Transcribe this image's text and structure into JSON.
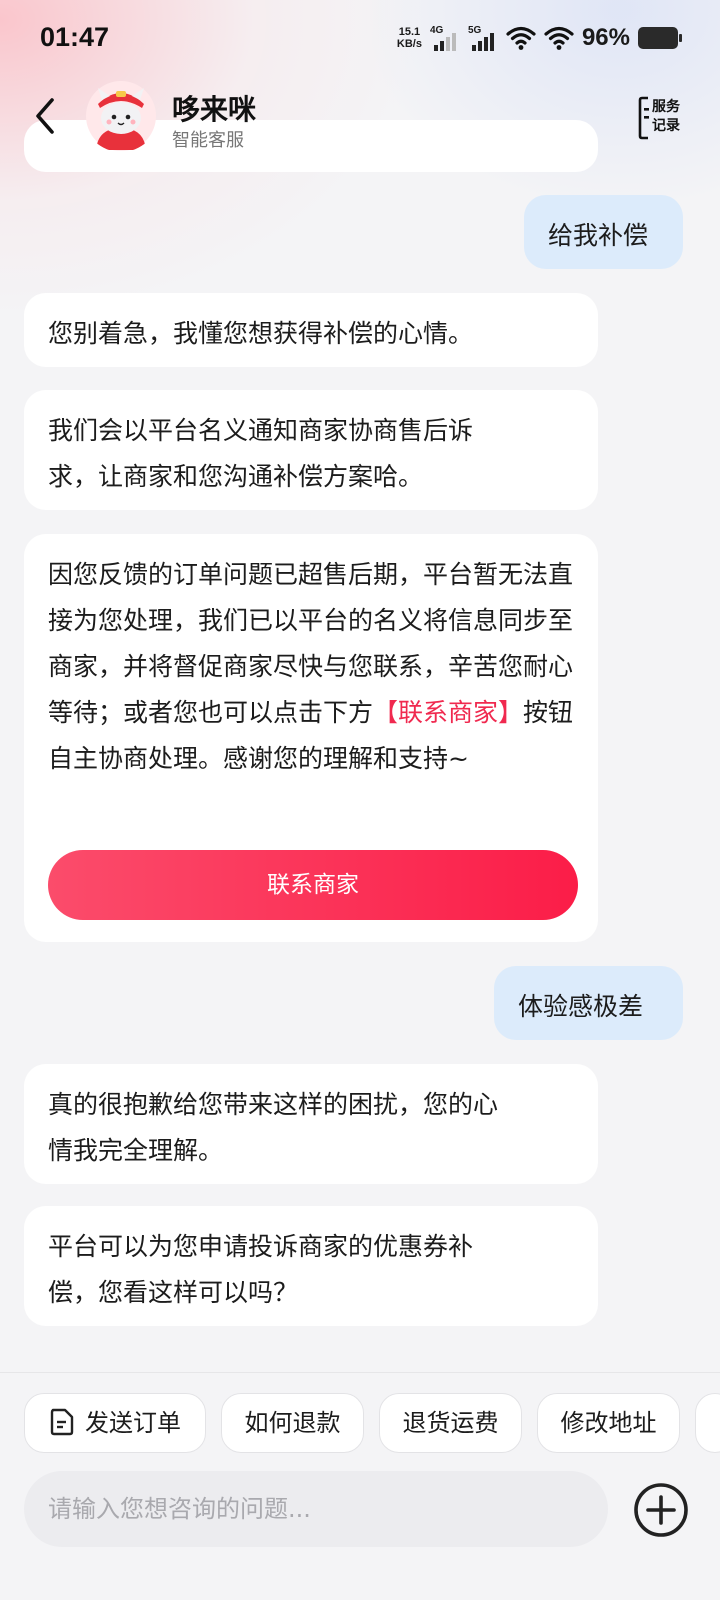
{
  "status": {
    "time": "01:47",
    "net_speed_value": "15.1",
    "net_speed_unit": "KB/s",
    "sim1": "4G",
    "sim2": "5G",
    "battery": "96%"
  },
  "header": {
    "title": "哆来咪",
    "subtitle": "智能客服",
    "service_record_line1": "服务",
    "service_record_line2": "记录"
  },
  "messages": [
    {
      "role": "user",
      "text": "给我补偿"
    },
    {
      "role": "bot",
      "text": "您别着急，我懂您想获得补偿的心情。"
    },
    {
      "role": "bot",
      "text_line1": "我们会以平台名义通知商家协商售后诉",
      "text_line2": "求，让商家和您沟通补偿方案哈。"
    },
    {
      "role": "bot",
      "text_before": "因您反馈的订单问题已超售后期，平台暂无法直接为您处理，我们已以平台的名义将信息同步至商家，并将督促商家尽快与您联系，辛苦您耐心等待；或者您也可以点击下方",
      "highlight": "【联系商家】",
      "text_after": "按钮自主协商处理。感谢您的理解和支持~",
      "button": "联系商家"
    },
    {
      "role": "user",
      "text": "体验感极差"
    },
    {
      "role": "bot",
      "text_line1": "真的很抱歉给您带来这样的困扰，您的心",
      "text_line2": "情我完全理解。"
    },
    {
      "role": "bot",
      "text_line1": "平台可以为您申请投诉商家的优惠券补",
      "text_line2": "偿，您看这样可以吗？"
    }
  ],
  "quick_replies": [
    "发送订单",
    "如何退款",
    "退货运费",
    "修改地址"
  ],
  "input": {
    "placeholder": "请输入您想咨询的问题..."
  },
  "colors": {
    "accent": "#fb2d52",
    "user_bubble": "#dcebfb",
    "background": "#f4f4f6"
  }
}
